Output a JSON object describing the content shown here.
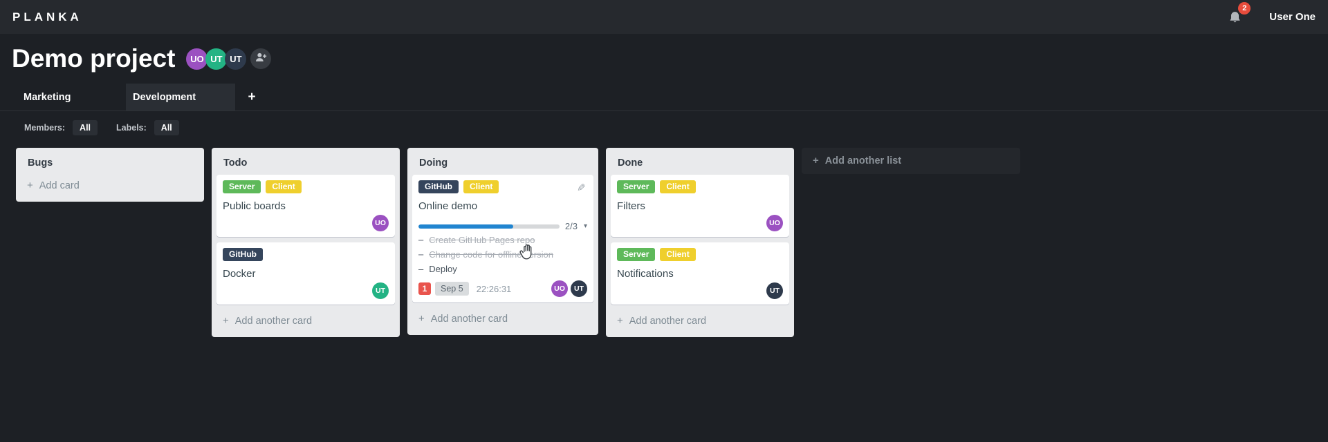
{
  "colors": {
    "topbar_bg": "#26292e",
    "board_bg": "#1d2025",
    "list_bg": "#e9eaec",
    "card_bg": "#ffffff",
    "label_green": "#5eb95a",
    "label_yellow": "#efcf2d",
    "label_navy": "#35455c",
    "progress_blue": "#2185d0",
    "notification_red": "#e74c3c",
    "avatar_purple": "#9b51c1",
    "avatar_green": "#23b384",
    "avatar_navy": "#2e3a4c"
  },
  "app": {
    "logo": "PLANKA",
    "notification_count": "2",
    "user_name": "User One"
  },
  "project": {
    "title": "Demo project",
    "members": [
      {
        "initials": "UO"
      },
      {
        "initials": "UT"
      },
      {
        "initials": "UT"
      }
    ]
  },
  "tabs": {
    "items": [
      {
        "label": "Marketing"
      },
      {
        "label": "Development"
      }
    ],
    "add_label": "+"
  },
  "filters": {
    "members_label": "Members:",
    "members_value": "All",
    "labels_label": "Labels:",
    "labels_value": "All"
  },
  "board": {
    "add_list_label": "Add another list",
    "lists": [
      {
        "title": "Bugs",
        "add_label": "Add card",
        "cards": []
      },
      {
        "title": "Todo",
        "add_label": "Add another card",
        "cards": [
          {
            "title": "Public boards",
            "labels": [
              "Server",
              "Client"
            ],
            "members": [
              "UO"
            ]
          },
          {
            "title": "Docker",
            "labels": [
              "GitHub"
            ],
            "members": [
              "UT"
            ]
          }
        ]
      },
      {
        "title": "Doing",
        "add_label": "Add another card",
        "cards": [
          {
            "title": "Online demo",
            "labels": [
              "GitHub",
              "Client"
            ],
            "progress_label": "2/3",
            "progress_percent": 67,
            "tasks": [
              {
                "text": "Create GitHub Pages repo",
                "done": true
              },
              {
                "text": "Change code for offline version",
                "done": true
              },
              {
                "text": "Deploy",
                "done": false
              }
            ],
            "notification_count": "1",
            "due_date": "Sep 5",
            "stopwatch": "22:26:31",
            "members": [
              "UO",
              "UT"
            ]
          }
        ]
      },
      {
        "title": "Done",
        "add_label": "Add another card",
        "cards": [
          {
            "title": "Filters",
            "labels": [
              "Server",
              "Client"
            ],
            "members": [
              "UO"
            ]
          },
          {
            "title": "Notifications",
            "labels": [
              "Server",
              "Client"
            ],
            "members": [
              "UT"
            ]
          }
        ]
      }
    ]
  },
  "glyphs": {
    "plus": "+",
    "chevron_down": "▾",
    "pencil": "✎",
    "dash": "–"
  }
}
